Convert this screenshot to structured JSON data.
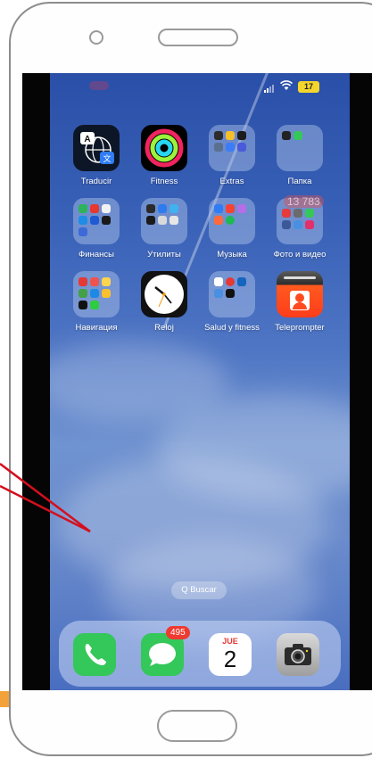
{
  "status_bar": {
    "battery": "17",
    "icons": [
      "signal-icon",
      "wifi-icon",
      "battery-icon"
    ]
  },
  "apps": [
    {
      "label": "Traducir",
      "icon": "translate-icon"
    },
    {
      "label": "Fitness",
      "icon": "fitness-rings-icon"
    },
    {
      "label": "Extras",
      "icon": "folder-icon"
    },
    {
      "label": "Папка",
      "icon": "folder-icon"
    },
    {
      "label": "Финансы",
      "icon": "folder-icon"
    },
    {
      "label": "Утилиты",
      "icon": "folder-icon"
    },
    {
      "label": "Музыка",
      "icon": "folder-icon"
    },
    {
      "label": "Фото и видео",
      "icon": "folder-icon",
      "badge": "13 783"
    },
    {
      "label": "Навигация",
      "icon": "folder-icon"
    },
    {
      "label": "Reloj",
      "icon": "clock-icon"
    },
    {
      "label": "Salud y fitness",
      "icon": "folder-icon"
    },
    {
      "label": "Teleprompter",
      "icon": "teleprompter-icon"
    }
  ],
  "search": {
    "label": "Q Buscar"
  },
  "dock": {
    "phone": {
      "icon": "phone-icon"
    },
    "messages": {
      "icon": "messages-icon",
      "badge": "495"
    },
    "calendar": {
      "icon": "calendar-icon",
      "weekday": "JUE",
      "day": "2"
    },
    "camera": {
      "icon": "camera-icon"
    }
  },
  "colors": {
    "accent_red": "#ee3a31",
    "annotation_red": "#d40f1e",
    "wallpaper": "#3a62b8",
    "battery": "#f4d52b"
  }
}
